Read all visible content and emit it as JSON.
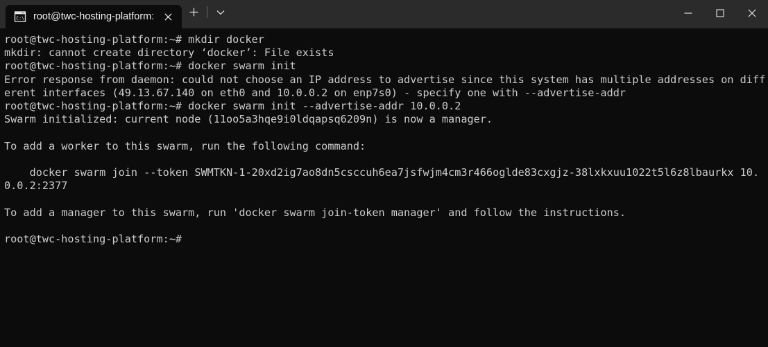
{
  "window": {
    "titlebar": {
      "tab": {
        "icon": "command-prompt-icon",
        "title": "root@twc-hosting-platform: ·",
        "close_label": "✕"
      },
      "new_tab_label": "+",
      "dropdown_label": "⌄",
      "controls": {
        "minimize_label": "—",
        "maximize_label": "☐",
        "close_label": "✕"
      }
    },
    "terminal": {
      "foreground": "#cccccc",
      "background": "#0c0c0c",
      "prompt": "root@twc-hosting-platform:~#",
      "lines": [
        "root@twc-hosting-platform:~# mkdir docker",
        "mkdir: cannot create directory ‘docker’: File exists",
        "root@twc-hosting-platform:~# docker swarm init",
        "Error response from daemon: could not choose an IP address to advertise since this system has multiple addresses on different interfaces (49.13.67.140 on eth0 and 10.0.0.2 on enp7s0) - specify one with --advertise-addr",
        "root@twc-hosting-platform:~# docker swarm init --advertise-addr 10.0.0.2",
        "Swarm initialized: current node (11oo5a3hqe9i0ldqapsq6209n) is now a manager.",
        "",
        "To add a worker to this swarm, run the following command:",
        "",
        "    docker swarm join --token SWMTKN-1-20xd2ig7ao8dn5csccuh6ea7jsfwjm4cm3r466oglde83cxgjz-38lxkxuu1022t5l6z8lbaurkx 10.0.0.2:2377",
        "",
        "To add a manager to this swarm, run 'docker swarm join-token manager' and follow the instructions.",
        "",
        "root@twc-hosting-platform:~# "
      ]
    }
  }
}
